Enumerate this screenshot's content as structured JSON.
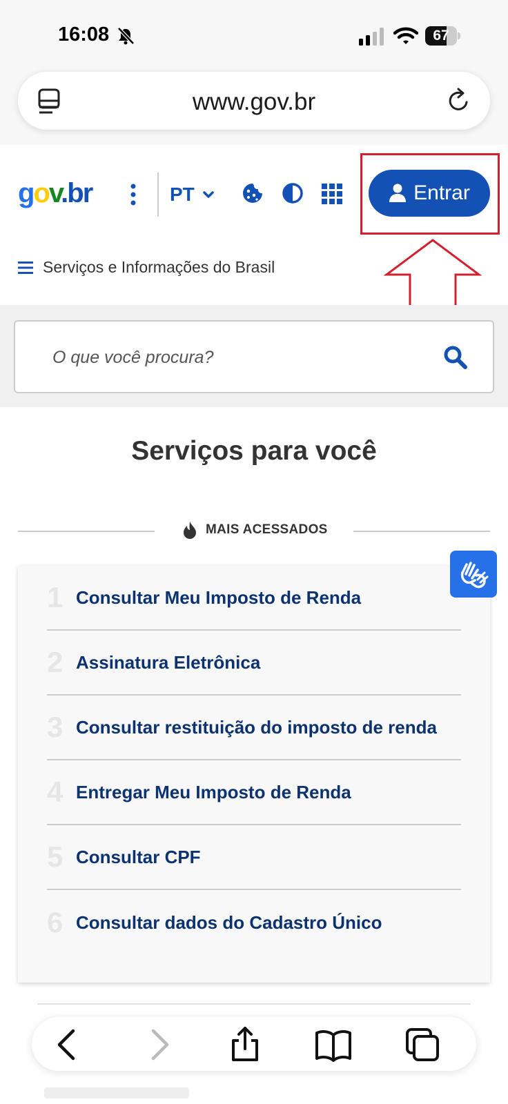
{
  "status_bar": {
    "time": "16:08",
    "battery": "67",
    "battery_level": 0.67
  },
  "browser": {
    "url": "www.gov.br"
  },
  "header": {
    "logo": {
      "g": "g",
      "o": "o",
      "v": "v",
      "dot": ".",
      "b": "b",
      "r": "r"
    },
    "language": "PT",
    "login_label": "Entrar",
    "menu_label": "Serviços e Informações do Brasil"
  },
  "search": {
    "placeholder": "O que você procura?"
  },
  "services": {
    "title": "Serviços para você",
    "section_label": "MAIS ACESSADOS",
    "items": [
      {
        "num": "1",
        "label": "Consultar Meu Imposto de Renda"
      },
      {
        "num": "2",
        "label": "Assinatura Eletrônica"
      },
      {
        "num": "3",
        "label": "Consultar restituição do imposto de renda"
      },
      {
        "num": "4",
        "label": "Entregar Meu Imposto de Renda"
      },
      {
        "num": "5",
        "label": "Consultar CPF"
      },
      {
        "num": "6",
        "label": "Consultar dados do Cadastro Único"
      }
    ]
  },
  "colors": {
    "primary": "#1351b4",
    "link": "#0c326f",
    "annotation": "#d3202f",
    "libras": "#2670e8"
  },
  "toolbar": {
    "icons": [
      "back-icon",
      "forward-icon",
      "share-icon",
      "bookmarks-icon",
      "tabs-icon"
    ]
  }
}
